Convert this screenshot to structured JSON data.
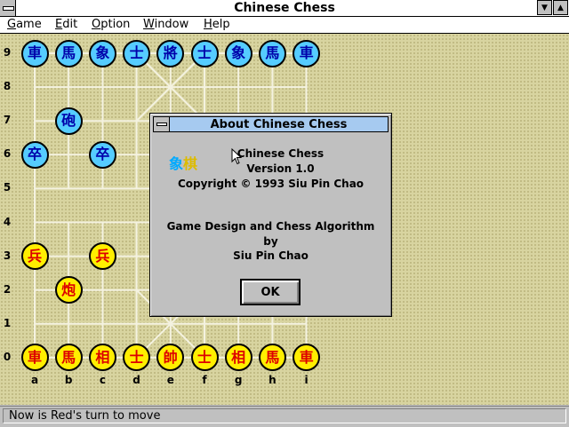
{
  "window": {
    "title": "Chinese Chess",
    "minimize_glyph": "▼",
    "maximize_glyph": "▲"
  },
  "menu": {
    "items": [
      {
        "accel": "G",
        "rest": "ame"
      },
      {
        "accel": "E",
        "rest": "dit"
      },
      {
        "accel": "O",
        "rest": "ption"
      },
      {
        "accel": "W",
        "rest": "indow"
      },
      {
        "accel": "H",
        "rest": "elp"
      }
    ]
  },
  "board": {
    "ranks": [
      "9",
      "8",
      "7",
      "6",
      "5",
      "4",
      "3",
      "2",
      "1",
      "0"
    ],
    "files": [
      "a",
      "b",
      "c",
      "d",
      "e",
      "f",
      "g",
      "h",
      "i"
    ],
    "pieces": [
      {
        "char": "車",
        "side": "blue",
        "file": 0,
        "rank": 9
      },
      {
        "char": "馬",
        "side": "blue",
        "file": 1,
        "rank": 9
      },
      {
        "char": "象",
        "side": "blue",
        "file": 2,
        "rank": 9
      },
      {
        "char": "士",
        "side": "blue",
        "file": 3,
        "rank": 9
      },
      {
        "char": "將",
        "side": "blue",
        "file": 4,
        "rank": 9
      },
      {
        "char": "士",
        "side": "blue",
        "file": 5,
        "rank": 9
      },
      {
        "char": "象",
        "side": "blue",
        "file": 6,
        "rank": 9
      },
      {
        "char": "馬",
        "side": "blue",
        "file": 7,
        "rank": 9
      },
      {
        "char": "車",
        "side": "blue",
        "file": 8,
        "rank": 9
      },
      {
        "char": "砲",
        "side": "blue",
        "file": 1,
        "rank": 7
      },
      {
        "char": "卒",
        "side": "blue",
        "file": 0,
        "rank": 6
      },
      {
        "char": "卒",
        "side": "blue",
        "file": 2,
        "rank": 6
      },
      {
        "char": "兵",
        "side": "red",
        "file": 0,
        "rank": 3
      },
      {
        "char": "兵",
        "side": "red",
        "file": 2,
        "rank": 3
      },
      {
        "char": "炮",
        "side": "red",
        "file": 1,
        "rank": 2
      },
      {
        "char": "車",
        "side": "red",
        "file": 0,
        "rank": 0
      },
      {
        "char": "馬",
        "side": "red",
        "file": 1,
        "rank": 0
      },
      {
        "char": "相",
        "side": "red",
        "file": 2,
        "rank": 0
      },
      {
        "char": "士",
        "side": "red",
        "file": 3,
        "rank": 0
      },
      {
        "char": "帥",
        "side": "red",
        "file": 4,
        "rank": 0
      },
      {
        "char": "士",
        "side": "red",
        "file": 5,
        "rank": 0
      },
      {
        "char": "相",
        "side": "red",
        "file": 6,
        "rank": 0
      },
      {
        "char": "馬",
        "side": "red",
        "file": 7,
        "rank": 0
      },
      {
        "char": "車",
        "side": "red",
        "file": 8,
        "rank": 0
      }
    ]
  },
  "about_dialog": {
    "title": "About Chinese Chess",
    "logo_left": "象",
    "logo_right": "棋",
    "lines": [
      "Chinese Chess",
      "Version 1.0",
      "Copyright © 1993 Siu Pin Chao",
      "Game Design and Chess Algorithm",
      "by",
      "Siu Pin Chao"
    ],
    "ok_label": "OK"
  },
  "status": {
    "message": "Now is Red's turn to move"
  },
  "colors": {
    "blue_piece": "#55ccff",
    "red_piece": "#ffee00",
    "board": "#d8d4a0",
    "dialog_title": "#a6caf0"
  }
}
